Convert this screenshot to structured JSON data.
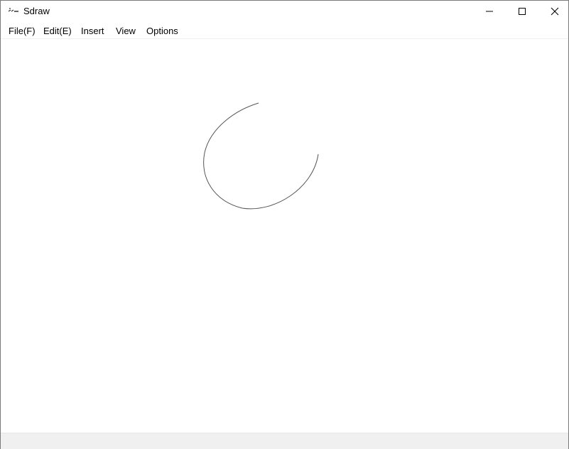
{
  "window": {
    "title": "Sdraw",
    "app_icon": "sdraw-app-icon",
    "controls": {
      "minimize_icon": "minimize-icon",
      "maximize_icon": "maximize-icon",
      "close_icon": "close-icon"
    }
  },
  "menubar": {
    "items": [
      {
        "label": "File(F)"
      },
      {
        "label": "Edit(E)"
      },
      {
        "label": "Insert"
      },
      {
        "label": "View"
      },
      {
        "label": "Options"
      }
    ]
  },
  "canvas": {
    "shapes": [
      {
        "type": "arc",
        "stroke": "#555555"
      }
    ]
  },
  "statusbar": {
    "background": "#f0f0f0"
  }
}
